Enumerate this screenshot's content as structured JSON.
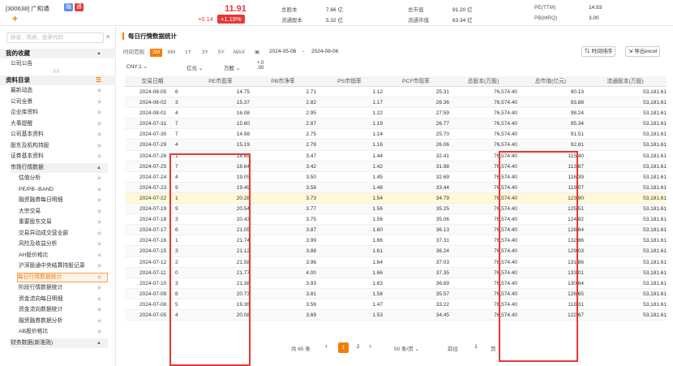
{
  "header": {
    "stock_name": "[300638] 广和通",
    "tag1": "融",
    "tag2": "通",
    "plus": "+",
    "price": "11.91",
    "change": "+0.14",
    "change_pct": "+1.19%",
    "info": [
      {
        "label": "总股本",
        "value": "7.66 亿"
      },
      {
        "label": "流通股本",
        "value": "5.32 亿"
      },
      {
        "label": "总市值",
        "value": "91.20 亿"
      },
      {
        "label": "流通市值",
        "value": "63.34 亿"
      },
      {
        "label": "PE(TTM)",
        "value": "14.93"
      },
      {
        "label": "PB(MRQ)",
        "value": "3.00"
      }
    ]
  },
  "sidebar": {
    "search_placeholder": "拼音、简拼、股票代码",
    "fav_title": "我的收藏",
    "fav_items": [
      "公司公告"
    ],
    "catalog_title": "资料目录",
    "items": [
      {
        "label": "最新动态",
        "level": 1
      },
      {
        "label": "公司全景",
        "level": 1
      },
      {
        "label": "企业库资料",
        "level": 1
      },
      {
        "label": "大事提醒",
        "level": 1
      },
      {
        "label": "公司基本资料",
        "level": 1
      },
      {
        "label": "股东及机构持股",
        "level": 1
      },
      {
        "label": "证券基本资料",
        "level": 1
      },
      {
        "label": "市场行情数据",
        "level": 1
      },
      {
        "label": "估值分析",
        "level": 2
      },
      {
        "label": "PE/PB -BAND",
        "level": 2
      },
      {
        "label": "融资融券每日明细",
        "level": 2
      },
      {
        "label": "大宗交易",
        "level": 2
      },
      {
        "label": "重要股东交易",
        "level": 2
      },
      {
        "label": "交易异动成交营业部",
        "level": 2
      },
      {
        "label": "风险及收益分析",
        "level": 2
      },
      {
        "label": "AH股价格比",
        "level": 2
      },
      {
        "label": "沪深股通中央结算持股记录",
        "level": 2
      },
      {
        "label": "每日行情数据统计",
        "level": 2
      },
      {
        "label": "阶段行情数据统计",
        "level": 2
      },
      {
        "label": "资金流向每日明细",
        "level": 2
      },
      {
        "label": "资金流向数据统计",
        "level": 2
      },
      {
        "label": "融资融券数据分析",
        "level": 2
      },
      {
        "label": "AB股价格比",
        "level": 2
      },
      {
        "label": "财务数据(新准则)",
        "level": 1
      }
    ],
    "active_index": 17
  },
  "main": {
    "title": "每日行情数据统计",
    "range_label": "时间范围",
    "ranges": [
      "3M",
      "6M",
      "1Y",
      "3Y",
      "5Y",
      "MAX"
    ],
    "active_range": "3M",
    "date_from": "2024-05-06",
    "date_sep": "-",
    "date_to": "2024-08-06",
    "sort_button": "时间排序",
    "export_button": "导出excel",
    "currency": "CNY:1",
    "unit1": "亿元",
    "unit2": "万股",
    "decimal_icon": "+.0 .00",
    "columns": [
      "交易日期",
      "PE市盈率",
      "PB市净率",
      "PS市销率",
      "PCF市现率",
      "总股本(万股)",
      "总市值(亿元)",
      "流通股本(万股)"
    ],
    "rows": [
      [
        "2024-08-05",
        "6",
        "14.75",
        "2.71",
        "1.12",
        "25.31",
        "76,574.40",
        "90.13",
        "53,181.61"
      ],
      [
        "2024-08-02",
        "3",
        "15.37",
        "2.82",
        "1.17",
        "26.36",
        "76,574.40",
        "93.88",
        "53,181.61"
      ],
      [
        "2024-08-01",
        "4",
        "16.08",
        "2.95",
        "1.22",
        "27.59",
        "76,574.40",
        "98.24",
        "53,181.61"
      ],
      [
        "2024-07-31",
        "7",
        "15.60",
        "2.87",
        "1.19",
        "26.77",
        "76,574.40",
        "95.34",
        "53,181.61"
      ],
      [
        "2024-07-30",
        "7",
        "14.98",
        "2.75",
        "1.14",
        "25.70",
        "76,574.40",
        "91.51",
        "53,181.61"
      ],
      [
        "2024-07-29",
        "4",
        "15.19",
        "2.79",
        "1.16",
        "26.06",
        "76,574.40",
        "92.81",
        "53,181.61"
      ],
      [
        "2024-07-26",
        "1",
        "18.89",
        "3.47",
        "1.44",
        "32.41",
        "76,574.40",
        "115.40",
        "53,181.61"
      ],
      [
        "2024-07-25",
        "7",
        "18.64",
        "3.42",
        "1.42",
        "31.98",
        "76,574.40",
        "113.87",
        "53,181.61"
      ],
      [
        "2024-07-24",
        "4",
        "19.05",
        "3.50",
        "1.45",
        "32.69",
        "76,574.40",
        "116.39",
        "53,181.61"
      ],
      [
        "2024-07-23",
        "9",
        "19.49",
        "3.58",
        "1.48",
        "33.44",
        "76,574.40",
        "119.07",
        "53,181.61"
      ],
      [
        "2024-07-22",
        "1",
        "20.28",
        "3.73",
        "1.54",
        "34.79",
        "76,574.40",
        "123.90",
        "53,181.61"
      ],
      [
        "2024-07-19",
        "9",
        "20.54",
        "3.77",
        "1.56",
        "35.25",
        "76,574.40",
        "125.51",
        "53,181.61"
      ],
      [
        "2024-07-18",
        "3",
        "20.43",
        "3.75",
        "1.56",
        "35.06",
        "76,574.40",
        "124.82",
        "53,181.61"
      ],
      [
        "2024-07-17",
        "6",
        "21.05",
        "3.87",
        "1.60",
        "36.13",
        "76,574.40",
        "128.64",
        "53,181.61"
      ],
      [
        "2024-07-16",
        "1",
        "21.74",
        "3.99",
        "1.66",
        "37.31",
        "76,574.40",
        "132.86",
        "53,181.61"
      ],
      [
        "2024-07-15",
        "3",
        "21.12",
        "3.88",
        "1.61",
        "36.24",
        "76,574.40",
        "129.03",
        "53,181.61"
      ],
      [
        "2024-07-12",
        "2",
        "21.58",
        "3.96",
        "1.64",
        "37.03",
        "76,574.40",
        "131.86",
        "53,181.61"
      ],
      [
        "2024-07-11",
        "0",
        "21.77",
        "4.00",
        "1.66",
        "37.35",
        "76,574.40",
        "133.01",
        "53,181.61"
      ],
      [
        "2024-07-10",
        "3",
        "21.38",
        "3.93",
        "1.63",
        "36.69",
        "76,574.40",
        "130.64",
        "53,181.61"
      ],
      [
        "2024-07-09",
        "8",
        "20.73",
        "3.81",
        "1.58",
        "35.57",
        "76,574.40",
        "126.65",
        "53,181.61"
      ],
      [
        "2024-07-08",
        "5",
        "19.36",
        "3.56",
        "1.47",
        "33.22",
        "76,574.40",
        "118.31",
        "53,181.61"
      ],
      [
        "2024-07-05",
        "4",
        "20.08",
        "3.69",
        "1.53",
        "34.45",
        "76,574.40",
        "122.67",
        "53,181.61"
      ]
    ],
    "highlight_row": 10,
    "pager": {
      "total": "共 65 条",
      "prev": "‹",
      "pages": [
        "1",
        "2"
      ],
      "active_page": "1",
      "next": "›",
      "per_page": "50 条/页",
      "goto_label": "前往",
      "goto_value": "1",
      "goto_suffix": "页"
    }
  }
}
